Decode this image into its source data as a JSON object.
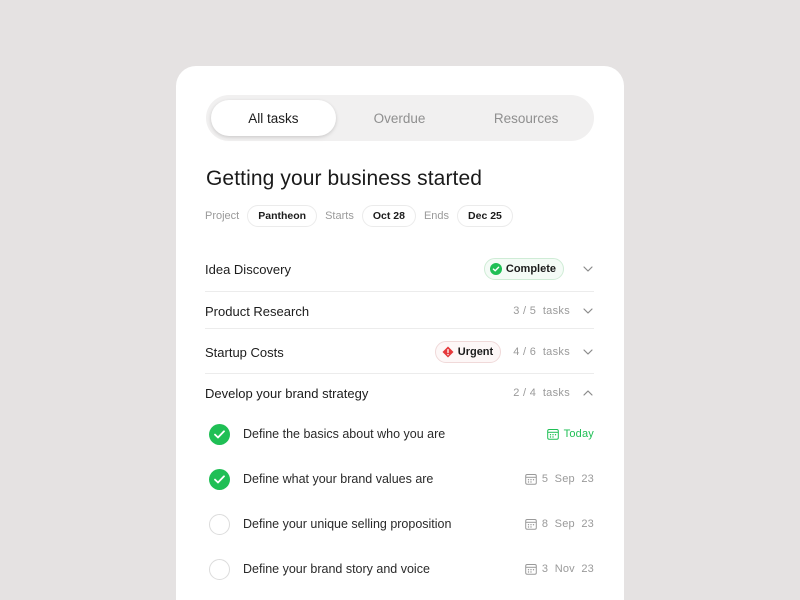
{
  "tabs": [
    {
      "label": "All tasks",
      "active": true
    },
    {
      "label": "Overdue",
      "active": false
    },
    {
      "label": "Resources",
      "active": false
    }
  ],
  "project": {
    "title": "Getting your business started",
    "project_label": "Project",
    "project_name": "Pantheon",
    "starts_label": "Starts",
    "starts_date": "Oct 28",
    "ends_label": "Ends",
    "ends_date": "Dec 25"
  },
  "sections": [
    {
      "name": "Idea Discovery",
      "badge": "Complete",
      "chevron": "chevron-down-icon"
    },
    {
      "name": "Product Research",
      "count": "3 / 5  tasks",
      "chevron": "chevron-down-icon"
    },
    {
      "name": "Startup Costs",
      "badge": "Urgent",
      "count": "4 / 6  tasks",
      "chevron": "chevron-down-icon"
    },
    {
      "name": "Develop your brand strategy",
      "count": "2 / 4  tasks",
      "chevron": "chevron-up-icon"
    }
  ],
  "tasks": [
    {
      "name": "Define the basics about who you are",
      "done": true,
      "due": "Today"
    },
    {
      "name": "Define what your brand values are",
      "done": true,
      "due": "5  Sep  23"
    },
    {
      "name": "Define your unique selling proposition",
      "done": false,
      "due": "8  Sep  23"
    },
    {
      "name": "Define your brand story and voice",
      "done": false,
      "due": "3  Nov  23"
    }
  ],
  "colors": {
    "background": "#e5e2e2",
    "success": "#1fbf55",
    "urgent": "#e5383b",
    "muted": "#9a9a9a"
  }
}
